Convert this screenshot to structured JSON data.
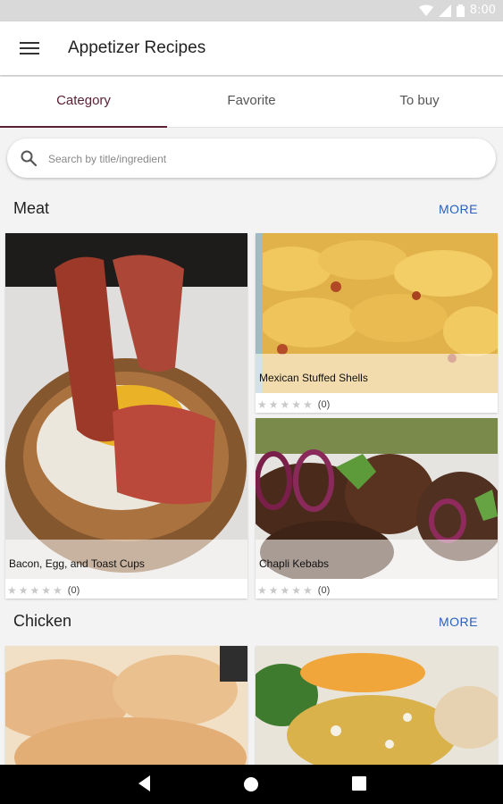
{
  "status_bar": {
    "time": "8:00"
  },
  "app_bar": {
    "title": "Appetizer Recipes"
  },
  "tabs": [
    {
      "label": "Category",
      "active": true
    },
    {
      "label": "Favorite",
      "active": false
    },
    {
      "label": "To buy",
      "active": false
    }
  ],
  "search": {
    "placeholder": "Search by title/ingredient"
  },
  "sections": [
    {
      "title": "Meat",
      "more_label": "MORE",
      "recipes": [
        {
          "title": "Bacon, Egg, and Toast Cups",
          "rating_count": "(0)"
        },
        {
          "title": "Mexican Stuffed Shells",
          "rating_count": "(0)"
        },
        {
          "title": "Chapli Kebabs",
          "rating_count": "(0)"
        }
      ]
    },
    {
      "title": "Chicken",
      "more_label": "MORE",
      "recipes": []
    }
  ],
  "rating": {
    "stars": "★★★★★"
  },
  "colors": {
    "accent": "#5c2233",
    "link": "#2962b8"
  },
  "icons": [
    "menu-icon",
    "search-icon",
    "wifi-icon",
    "signal-icon",
    "battery-icon",
    "back-icon",
    "home-icon",
    "recents-icon"
  ]
}
